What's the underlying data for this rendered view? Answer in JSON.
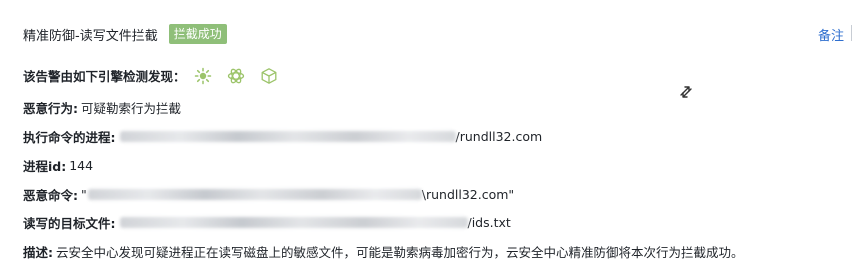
{
  "header": {
    "title": "精准防御-读写文件拦截",
    "status_badge": "拦截成功",
    "remark_link": "备注"
  },
  "detection": {
    "label": "该告警由如下引擎检测发现：",
    "engines": [
      "sun-engine-icon",
      "atom-engine-icon",
      "cube-engine-icon"
    ]
  },
  "fields": {
    "malicious_behavior": {
      "label": "恶意行为:",
      "value": "可疑勒索行为拦截"
    },
    "executing_process": {
      "label": "执行命令的进程:",
      "value_suffix": "/rundll32.com"
    },
    "process_id": {
      "label": "进程id:",
      "value": "144"
    },
    "malicious_command": {
      "label": "恶意命令:",
      "value_prefix": "\"",
      "value_suffix": "\\rundll32.com\""
    },
    "target_file": {
      "label": "读写的目标文件:",
      "value_suffix": "/ids.txt"
    },
    "description": {
      "label": "描述:",
      "value": "云安全中心发现可疑进程正在读写磁盘上的敏感文件，可能是勒索病毒加密行为，云安全中心精准防御将本次行为拦截成功。"
    }
  },
  "colors": {
    "badge_bg": "#8fbf79",
    "link": "#2f6fcf",
    "engine_icon": "#9cc46a"
  }
}
